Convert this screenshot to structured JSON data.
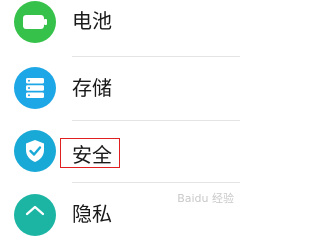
{
  "settings_list": {
    "items": [
      {
        "label": "电池",
        "icon": "battery-icon",
        "color": "#36c24a"
      },
      {
        "label": "存储",
        "icon": "storage-icon",
        "color": "#1ea7e6"
      },
      {
        "label": "安全",
        "icon": "shield-icon",
        "color": "#19a9d6",
        "highlighted": true
      },
      {
        "label": "隐私",
        "icon": "privacy-icon",
        "color": "#1cb5a4"
      }
    ]
  },
  "highlight": {
    "color": "#e02020"
  },
  "watermark": {
    "text": "Baidu 经验"
  }
}
